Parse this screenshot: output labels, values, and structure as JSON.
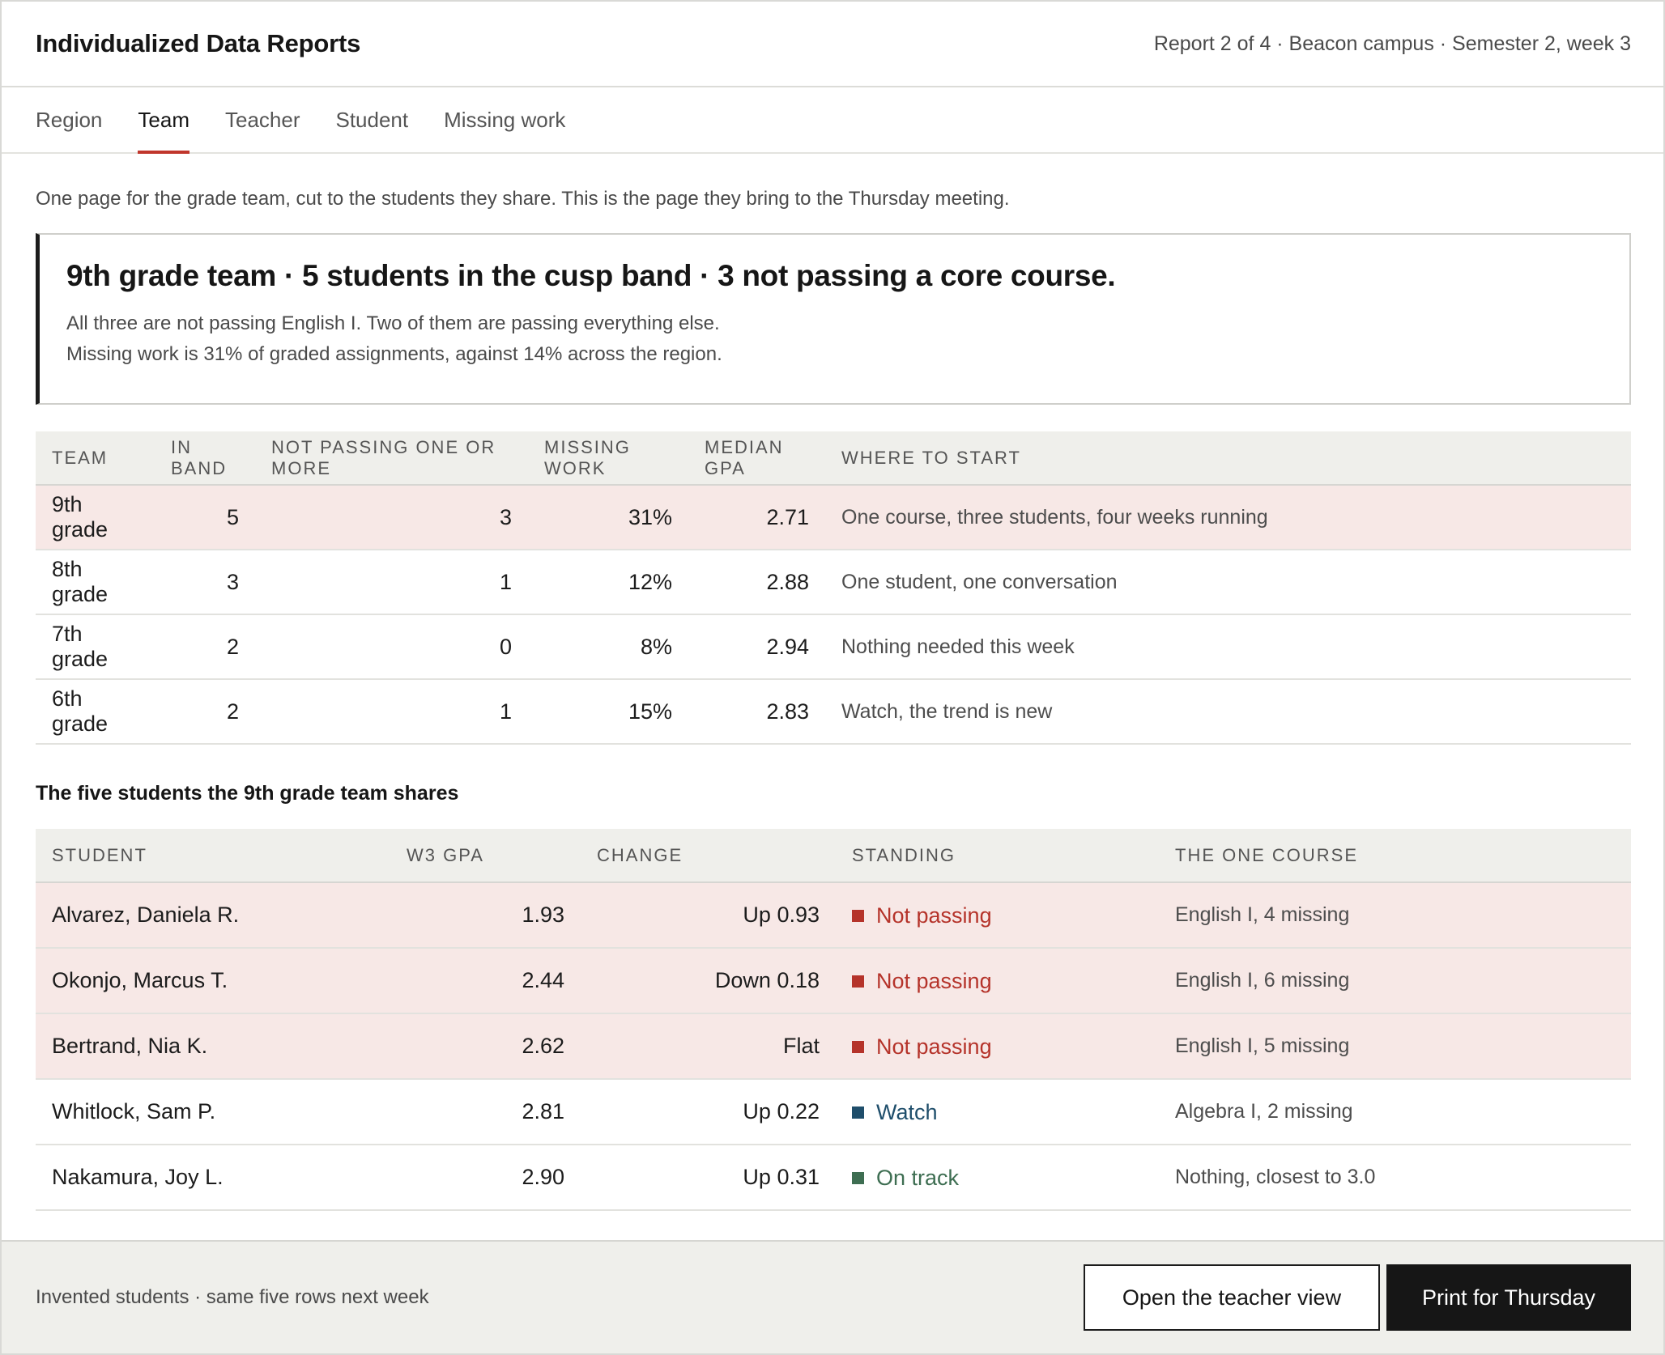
{
  "header": {
    "title": "Individualized Data Reports",
    "meta": "Report 2 of 4 · Beacon campus · Semester 2, week 3"
  },
  "tabs": [
    {
      "label": "Region",
      "active": false
    },
    {
      "label": "Team",
      "active": true
    },
    {
      "label": "Teacher",
      "active": false
    },
    {
      "label": "Student",
      "active": false
    },
    {
      "label": "Missing work",
      "active": false
    }
  ],
  "intro": "One page for the grade team, cut to the students they share. This is the page they bring to the Thursday meeting.",
  "callout": {
    "headline": "9th grade team · 5 students in the cusp band · 3 not passing a core course.",
    "line1": "All three are not passing English I. Two of them are passing everything else.",
    "line2": "Missing work is 31% of graded assignments, against 14% across the region."
  },
  "teams_table": {
    "headers": [
      "Team",
      "In band",
      "Not passing one or more",
      "Missing work",
      "Median GPA",
      "Where to start"
    ],
    "rows": [
      {
        "team": "9th grade",
        "in_band": "5",
        "not_passing": "3",
        "missing": "31%",
        "gpa": "2.71",
        "start": "One course, three students, four weeks running",
        "highlight": true
      },
      {
        "team": "8th grade",
        "in_band": "3",
        "not_passing": "1",
        "missing": "12%",
        "gpa": "2.88",
        "start": "One student, one conversation",
        "highlight": false
      },
      {
        "team": "7th grade",
        "in_band": "2",
        "not_passing": "0",
        "missing": "8%",
        "gpa": "2.94",
        "start": "Nothing needed this week",
        "highlight": false
      },
      {
        "team": "6th grade",
        "in_band": "2",
        "not_passing": "1",
        "missing": "15%",
        "gpa": "2.83",
        "start": "Watch, the trend is new",
        "highlight": false
      }
    ]
  },
  "students_section_title": "The five students the 9th grade team shares",
  "students_table": {
    "headers": [
      "Student",
      "W3 GPA",
      "Change",
      "Standing",
      "The one course"
    ],
    "rows": [
      {
        "name": "Alvarez, Daniela R.",
        "gpa": "1.93",
        "change": "Up 0.93",
        "standing": "Not passing",
        "status": "red",
        "course": "English I, 4 missing",
        "highlight": true
      },
      {
        "name": "Okonjo, Marcus T.",
        "gpa": "2.44",
        "change": "Down 0.18",
        "standing": "Not passing",
        "status": "red",
        "course": "English I, 6 missing",
        "highlight": true
      },
      {
        "name": "Bertrand, Nia K.",
        "gpa": "2.62",
        "change": "Flat",
        "standing": "Not passing",
        "status": "red",
        "course": "English I, 5 missing",
        "highlight": true
      },
      {
        "name": "Whitlock, Sam P.",
        "gpa": "2.81",
        "change": "Up 0.22",
        "standing": "Watch",
        "status": "blue",
        "course": "Algebra I, 2 missing",
        "highlight": false
      },
      {
        "name": "Nakamura, Joy L.",
        "gpa": "2.90",
        "change": "Up 0.31",
        "standing": "On track",
        "status": "green",
        "course": "Nothing, closest to 3.0",
        "highlight": false
      }
    ]
  },
  "colors": {
    "accent": "#c0362c",
    "not_passing": "#b5332a",
    "watch": "#1f4e6b",
    "on_track": "#3e6e52",
    "highlight_row": "#f7e8e6"
  },
  "footer": {
    "note": "Invented students · same five rows next week",
    "secondary_button": "Open the teacher view",
    "primary_button": "Print for Thursday"
  }
}
